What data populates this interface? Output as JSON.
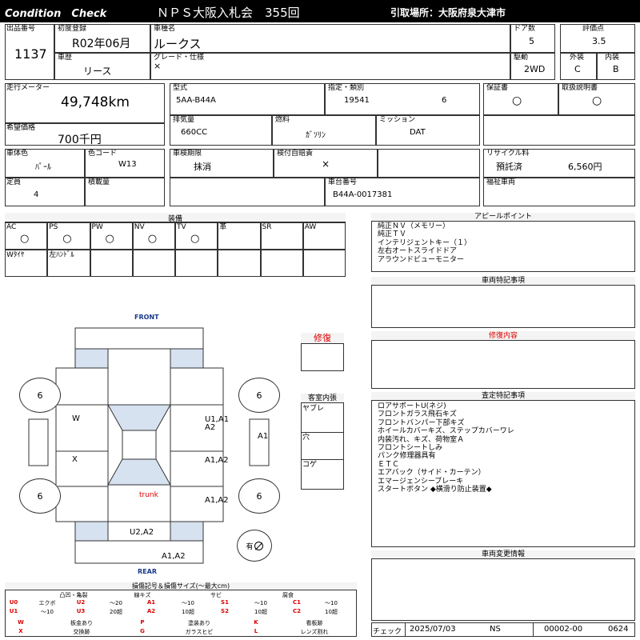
{
  "header": {
    "title_left": "Condition　Check",
    "auction": "ＮＰＳ大阪入札会　355回",
    "pickup": "引取場所：大阪府泉大津市"
  },
  "basic": {
    "lot_label": "出品番号",
    "lot": "1137",
    "first_reg_label": "初度登録",
    "first_reg": "R02年06月",
    "car_name_label": "車種名",
    "car_name": "ルークス",
    "door_label": "ドア数",
    "door": "5",
    "score_label": "評価点",
    "score": "3.5",
    "history_label": "車歴",
    "history": "リース",
    "grade_label": "グレード・仕様",
    "grade": "×",
    "drive_label": "駆動",
    "drive": "2WD",
    "ext_label": "外装",
    "ext": "C",
    "int_label": "内装",
    "int": "B"
  },
  "spec": {
    "mileage_label": "走行メーター",
    "mileage": "49,748km",
    "model_label": "型式",
    "model": "5AA-B44A",
    "designation_label": "指定・類別",
    "designation": "19541",
    "category": "6",
    "warranty_label": "保証書",
    "warranty": "○",
    "manual_label": "取扱説明書",
    "manual": "○",
    "price_label": "希望価格",
    "price": "700千円",
    "displacement_label": "排気量",
    "displacement": "660CC",
    "fuel_label": "燃料",
    "fuel": "ｶﾞｿﾘﾝ",
    "mission_label": "ミッション",
    "mission": "DAT",
    "color_label": "車体色",
    "color": "ﾊﾟｰﾙ",
    "color_code_label": "色コード",
    "color_code": "W13",
    "inspection_label": "車検期限",
    "inspection": "抹消",
    "insurance_label": "検付自賠責",
    "insurance": "×",
    "recycle_label": "リサイクル料",
    "recycle_status": "預託済",
    "recycle_amount": "6,560円",
    "capacity_label": "定員",
    "capacity": "4",
    "load_label": "積載量",
    "load": "",
    "chassis_label": "車台番号",
    "chassis": "B44A-0017381",
    "welfare_label": "福祉車両",
    "welfare": ""
  },
  "equipment": {
    "title": "装備",
    "row1": [
      {
        "label": "AC",
        "value": "○"
      },
      {
        "label": "PS",
        "value": "○"
      },
      {
        "label": "PW",
        "value": "○"
      },
      {
        "label": "NV",
        "value": "○"
      },
      {
        "label": "TV",
        "value": "○"
      },
      {
        "label": "革",
        "value": ""
      },
      {
        "label": "SR",
        "value": ""
      },
      {
        "label": "AW",
        "value": ""
      }
    ],
    "row2": [
      "Wﾀｲﾔ",
      "左ﾊﾝﾄﾞﾙ",
      "",
      "",
      "",
      "",
      "",
      ""
    ]
  },
  "appeal": {
    "title": "アピールポイント",
    "lines": [
      "純正ＮＶ（メモリー）",
      "純正ＴＶ",
      "インテリジェントキー（１）",
      "左右オートスライドドア",
      "アラウンドビューモニター"
    ]
  },
  "vehicle_notes": {
    "title": "車両特記事項"
  },
  "repair_content": {
    "title": "修復内容"
  },
  "inspection_notes": {
    "title": "査定特記事項",
    "lines": [
      "ロアサポートU(ネジ)",
      "フロントガラス飛石キズ",
      "フロントバンパー下部キズ",
      "ホイールカバーキズ、ステップカバーワレ",
      "内装汚れ、キズ、荷物室Ａ",
      "フロントシートしみ",
      "パンク修理器具有",
      "ＥＴＣ",
      "エアバック（サイド・カーテン）",
      "エマージェンシーブレーキ",
      "スタートボタン ◆横滑り防止装置◆"
    ]
  },
  "change_info": {
    "title": "車両変更情報"
  },
  "diagram": {
    "front": "FRONT",
    "rear": "REAR",
    "trunk": "trunk",
    "tires": [
      "6",
      "6",
      "6",
      "6"
    ],
    "marks": {
      "left_front_door": "W",
      "left_rear_door": "X",
      "right_front_fender": "U1,A1\nA2",
      "right_front_door": "A1,A2",
      "right_rear_door": "A1,A2",
      "right_side": "A1",
      "rear_panel": "U2,A2",
      "rear_bumper": "A1,A2"
    },
    "spare_label": "有",
    "spare_icon": "no-symbol-icon"
  },
  "repair_box": {
    "title": "修復"
  },
  "interior": {
    "title": "客室内張",
    "items": [
      "ヤブレ",
      "穴",
      "コゲ"
    ]
  },
  "legend": {
    "title": "損傷記号＆損傷サイズ(～最大cm)",
    "groups": [
      "凸凹・亀裂",
      "線キズ",
      "サビ",
      "腐食"
    ],
    "row1": [
      "U0",
      "エクボ",
      "U2",
      "～20",
      "A1",
      "～10",
      "S1",
      "～10",
      "C1",
      "～10"
    ],
    "row2": [
      "U1",
      "～10",
      "U3",
      "20超",
      "A2",
      "10超",
      "S2",
      "10超",
      "C2",
      "10超"
    ],
    "row3": [
      "W",
      "板金あり",
      "P",
      "塗装あり",
      "K",
      "看板跡"
    ],
    "row4": [
      "X",
      "交換跡",
      "G",
      "ガラスヒビ",
      "L",
      "レンズ割れ"
    ]
  },
  "footer": {
    "check_label": "チェック",
    "date": "2025/07/03",
    "inspector": "NS",
    "code": "00002-00",
    "num": "0624"
  }
}
